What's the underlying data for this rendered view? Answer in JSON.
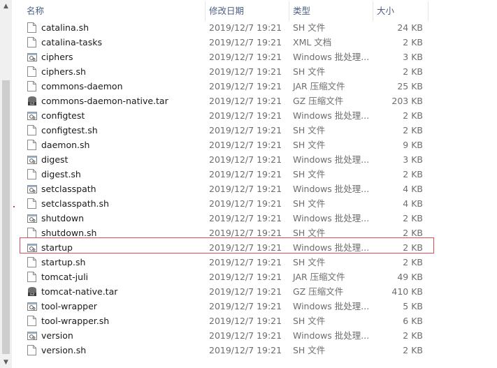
{
  "columns": {
    "name": "名称",
    "date": "修改日期",
    "type": "类型",
    "size": "大小"
  },
  "files": [
    {
      "name": "catalina.sh",
      "date": "2019/12/7 19:21",
      "type": "SH 文件",
      "size": "24 KB",
      "icon": "doc"
    },
    {
      "name": "catalina-tasks",
      "date": "2019/12/7 19:21",
      "type": "XML 文档",
      "size": "2 KB",
      "icon": "doc"
    },
    {
      "name": "ciphers",
      "date": "2019/12/7 19:21",
      "type": "Windows 批处理...",
      "size": "3 KB",
      "icon": "bat"
    },
    {
      "name": "ciphers.sh",
      "date": "2019/12/7 19:21",
      "type": "SH 文件",
      "size": "2 KB",
      "icon": "doc"
    },
    {
      "name": "commons-daemon",
      "date": "2019/12/7 19:21",
      "type": "JAR 压缩文件",
      "size": "25 KB",
      "icon": "doc"
    },
    {
      "name": "commons-daemon-native.tar",
      "date": "2019/12/7 19:21",
      "type": "GZ 压缩文件",
      "size": "203 KB",
      "icon": "gz"
    },
    {
      "name": "configtest",
      "date": "2019/12/7 19:21",
      "type": "Windows 批处理...",
      "size": "2 KB",
      "icon": "bat"
    },
    {
      "name": "configtest.sh",
      "date": "2019/12/7 19:21",
      "type": "SH 文件",
      "size": "2 KB",
      "icon": "doc"
    },
    {
      "name": "daemon.sh",
      "date": "2019/12/7 19:21",
      "type": "SH 文件",
      "size": "9 KB",
      "icon": "doc"
    },
    {
      "name": "digest",
      "date": "2019/12/7 19:21",
      "type": "Windows 批处理...",
      "size": "3 KB",
      "icon": "bat"
    },
    {
      "name": "digest.sh",
      "date": "2019/12/7 19:21",
      "type": "SH 文件",
      "size": "2 KB",
      "icon": "doc"
    },
    {
      "name": "setclasspath",
      "date": "2019/12/7 19:21",
      "type": "Windows 批处理...",
      "size": "4 KB",
      "icon": "bat"
    },
    {
      "name": "setclasspath.sh",
      "date": "2019/12/7 19:21",
      "type": "SH 文件",
      "size": "4 KB",
      "icon": "doc"
    },
    {
      "name": "shutdown",
      "date": "2019/12/7 19:21",
      "type": "Windows 批处理...",
      "size": "2 KB",
      "icon": "bat"
    },
    {
      "name": "shutdown.sh",
      "date": "2019/12/7 19:21",
      "type": "SH 文件",
      "size": "2 KB",
      "icon": "doc"
    },
    {
      "name": "startup",
      "date": "2019/12/7 19:21",
      "type": "Windows 批处理...",
      "size": "2 KB",
      "icon": "bat"
    },
    {
      "name": "startup.sh",
      "date": "2019/12/7 19:21",
      "type": "SH 文件",
      "size": "2 KB",
      "icon": "doc"
    },
    {
      "name": "tomcat-juli",
      "date": "2019/12/7 19:21",
      "type": "JAR 压缩文件",
      "size": "49 KB",
      "icon": "doc"
    },
    {
      "name": "tomcat-native.tar",
      "date": "2019/12/7 19:21",
      "type": "GZ 压缩文件",
      "size": "410 KB",
      "icon": "gz"
    },
    {
      "name": "tool-wrapper",
      "date": "2019/12/7 19:21",
      "type": "Windows 批处理...",
      "size": "5 KB",
      "icon": "bat"
    },
    {
      "name": "tool-wrapper.sh",
      "date": "2019/12/7 19:21",
      "type": "SH 文件",
      "size": "6 KB",
      "icon": "doc"
    },
    {
      "name": "version",
      "date": "2019/12/7 19:21",
      "type": "Windows 批处理...",
      "size": "2 KB",
      "icon": "bat"
    },
    {
      "name": "version.sh",
      "date": "2019/12/7 19:21",
      "type": "SH 文件",
      "size": "2 KB",
      "icon": "doc"
    }
  ],
  "highlighted_file": "startup",
  "colors": {
    "header_text": "#4d6082",
    "highlight_border": "#e64b58",
    "meta_text": "#6d6d6d"
  }
}
